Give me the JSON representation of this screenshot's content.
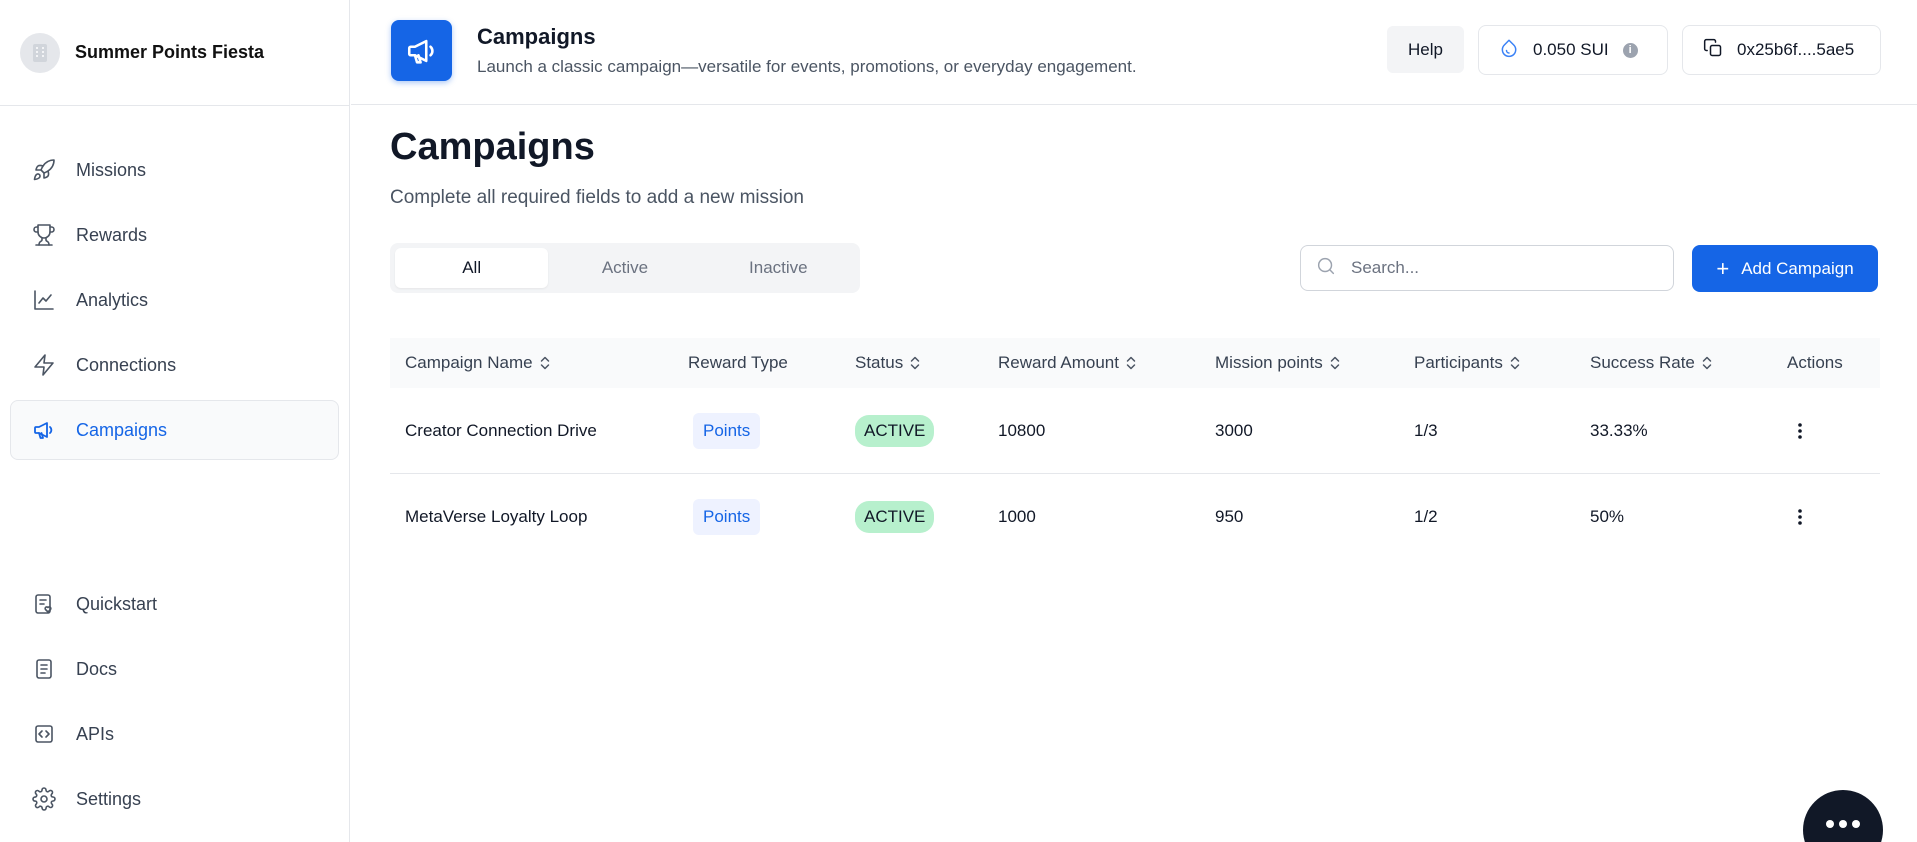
{
  "brand": {
    "name": "Summer Points Fiesta"
  },
  "sidebar": {
    "items": [
      {
        "label": "Missions",
        "icon": "rocket-icon"
      },
      {
        "label": "Rewards",
        "icon": "trophy-icon"
      },
      {
        "label": "Analytics",
        "icon": "chart-line-icon"
      },
      {
        "label": "Connections",
        "icon": "lightning-icon"
      },
      {
        "label": "Campaigns",
        "icon": "megaphone-icon",
        "active": true
      }
    ],
    "bottom": [
      {
        "label": "Quickstart",
        "icon": "clipboard-heart-icon"
      },
      {
        "label": "Docs",
        "icon": "document-icon"
      },
      {
        "label": "APIs",
        "icon": "code-icon"
      },
      {
        "label": "Settings",
        "icon": "gear-icon"
      }
    ]
  },
  "header": {
    "title": "Campaigns",
    "subtitle": "Launch a classic campaign—versatile for events, promotions, or everyday engagement.",
    "help_label": "Help",
    "balance": "0.050 SUI",
    "wallet": "0x25b6f....5ae5"
  },
  "main": {
    "title": "Campaigns",
    "subtitle": "Complete all required fields to add a new mission",
    "tabs": [
      "All",
      "Active",
      "Inactive"
    ],
    "active_tab": "All",
    "search_placeholder": "Search...",
    "add_button": "Add Campaign"
  },
  "table": {
    "columns": [
      "Campaign Name",
      "Reward Type",
      "Status",
      "Reward Amount",
      "Mission points",
      "Participants",
      "Success Rate",
      "Actions"
    ],
    "rows": [
      {
        "name": "Creator Connection Drive",
        "reward_type": "Points",
        "status": "ACTIVE",
        "reward_amount": "10800",
        "mission_points": "3000",
        "participants": "1/3",
        "success_rate": "33.33%"
      },
      {
        "name": "MetaVerse Loyalty Loop",
        "reward_type": "Points",
        "status": "ACTIVE",
        "reward_amount": "1000",
        "mission_points": "950",
        "participants": "1/2",
        "success_rate": "50%"
      }
    ]
  },
  "colors": {
    "accent": "#1565e6",
    "active_badge": "#b7f0cd",
    "points_badge": "#eef2ff"
  }
}
